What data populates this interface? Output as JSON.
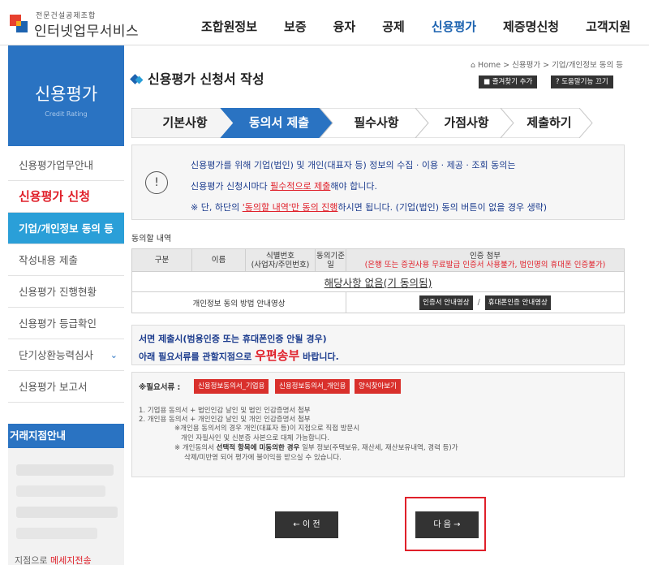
{
  "header": {
    "logo_small": "전문건설공제조합",
    "logo_main": "인터넷업무서비스",
    "nav": [
      "조합원정보",
      "보증",
      "융자",
      "공제",
      "신용평가",
      "제증명신청",
      "고객지원"
    ]
  },
  "sidebar": {
    "title": "신용평가",
    "subtitle": "Credit Rating",
    "items": [
      {
        "label": "신용평가업무안내"
      },
      {
        "label": "신용평가 신청"
      },
      {
        "label": "기업/개인정보 동의 등"
      },
      {
        "label": "작성내용 제출"
      },
      {
        "label": "신용평가 진행현황"
      },
      {
        "label": "신용평가 등급확인"
      },
      {
        "label": "단기상환능력심사"
      },
      {
        "label": "신용평가 보고서"
      }
    ],
    "branch_title": "거래지점안내",
    "branch_cut_text": "지점으로",
    "branch_cut_red": "메세지전송"
  },
  "page": {
    "title": "신용평가 신청서 작성",
    "breadcrumb": "⌂ Home > 신용평가 > 기업/개인정보 동의 등",
    "bookmark_btn": "■ 즐겨찾기 추가",
    "help_btn": "? 도움말기능 끄기"
  },
  "steps": [
    "기본사항",
    "동의서 제출",
    "필수사항",
    "가점사항",
    "제출하기"
  ],
  "notice": {
    "icon": "!",
    "line1": "신용평가를 위해 기업(법인) 및 개인(대표자 등) 정보의 수집 · 이용 · 제공 · 조회 동의는",
    "line2_a": "신용평가 신청시마다 ",
    "line2_red": "필수적으로 제출",
    "line2_b": "해야 합니다.",
    "line3_a": "※ 단, 하단의 ",
    "line3_red": "'동의할 내역'만 동의 진행",
    "line3_b": "하시면 됩니다. (기업(법인) 동의 버튼이 없을 경우 생략)"
  },
  "consent": {
    "label": "동의할 내역",
    "headers": [
      "구분",
      "이름",
      "식별번호\n(사업자/주민번호)",
      "동의기준\n일"
    ],
    "cert_header": "인증 첨부",
    "cert_note": "(은행 또는 증권사용 무료발급 인증서 사용불가, 법인명의 휴대폰 인증불가)",
    "none_text": "해당사항 없음(기 동의됨)",
    "guide_label": "개인정보 동의 방법 안내영상",
    "cert_guide_btn": "인증서 안내영상",
    "phone_guide_btn": "휴대폰인증 안내영상"
  },
  "mail": {
    "line1": "서면 제출시(범용인증 또는 휴대폰인증 안될 경우)",
    "line2_a": "아래 필요서류를 관할지점으로 ",
    "line2_big": "우편송부",
    "line2_b": " 바랍니다."
  },
  "docs": {
    "label": "※필요서류 :",
    "btn_corp": "신용정보동의서_기업용",
    "btn_person": "신용정보동의서_개인용",
    "btn_form": "양식찾아보기",
    "line1": "1. 기업용 동의서 + 법인인감 날인 및 법인 인감증명서 첨부",
    "line2": "2. 개인용 동의서 + 개인인감 날인 및 개인 인감증명서 첨부",
    "line3": "※개인용 동의서의 경우 개인(대표자 등)이 지점으로 직접 방문시",
    "line4": "개인 자필사인 및 신분증 사본으로 대체 가능합니다.",
    "line5_a": "※ 개인동의서 ",
    "line5_b": "선택적 항목에 미동의한 경우",
    "line5_c": " 일부 정보(주택보유, 재산세, 재산보유내역, 경력 등)가",
    "line6": "삭제/미반영 되어 평가에 불이익을 받으실 수 있습니다."
  },
  "buttons": {
    "prev": "← 이 전",
    "next": "다 음 →"
  }
}
